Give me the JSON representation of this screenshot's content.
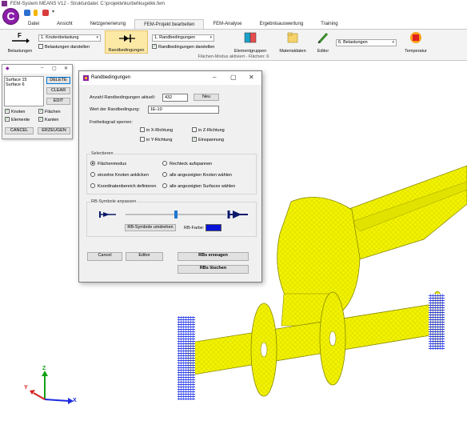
{
  "window": {
    "title": "FEM-System MEANS V12 - Strukturdatei: C:\\projekte\\kurbel\\kugelkk.fem",
    "logo_letter": "C"
  },
  "ribbon_tabs": [
    {
      "label": "Datei"
    },
    {
      "label": "Ansicht"
    },
    {
      "label": "Netzgenerierung"
    },
    {
      "label": "FEM-Projekt bearbeiten"
    },
    {
      "label": "FEM-Analyse"
    },
    {
      "label": "Ergebnisauswertung"
    },
    {
      "label": "Training"
    }
  ],
  "ribbon": {
    "belastungen_label": "Belastungen",
    "belastungen_icon_letter": "F",
    "knotenbelastung_combo": "1. Knotenbelastung",
    "belastungen_darstellen": "Belastungen darstellen",
    "randbedingungen_label": "Randbedingungen",
    "randbedingungen_combo": "1. Randbedingungen",
    "randbedingungen_darstellen": "Randbedingungen darstellen",
    "elementgruppen_label": "Elementgruppen",
    "materialdaten_label": "Materialdaten",
    "editor_label": "Editor",
    "belastungen_combo2": "6. Belastungen",
    "temperatur_label": "Temperatur",
    "group_status": "Flächen-Modus aktiviert - Flächen: 6"
  },
  "small_window": {
    "list_items": [
      "Surface 15",
      "Surface 6"
    ],
    "delete_label": "DELETE",
    "clear_label": "CLEAR",
    "edit_label": "EDIT",
    "knoten_label": "Knoten",
    "flaechen_label": "Flächen",
    "elemente_label": "Elemente",
    "kanten_label": "Kanten",
    "cancel_label": "CANCEL",
    "erzeugen_label": "ERZEUGEN"
  },
  "dialog": {
    "title": "Randbedingungen",
    "anzahl_label": "Anzahl Randbedingungen aktuell:",
    "anzahl_value": "432",
    "neu_label": "Neu",
    "wert_label": "Wert der Randbedingung:",
    "wert_value": "1E-10",
    "freiheitsgrad_label": "Freiheitsgrad sperren:",
    "in_x": "in X-Richtung",
    "in_y": "in Y-Richtung",
    "in_z": "in Z-Richtung",
    "einspannung": "Einspannung",
    "selectieren_label": "Selectieren",
    "flaechenmodus": "Flächenmodus",
    "einzelne_knoten": "einzelne Knoten anklicken",
    "koordinatenbereich": "Koordinatenbereich definieren",
    "rechteck": "Rechteck aufspannen",
    "alle_knoten": "alle angezeigten Knoten wählen",
    "alle_surfaces": "alle angezeigten Surfaces wählen",
    "rb_symbole_label": "RB-Symbole anpassen",
    "rb_symbole_umdrehen": "RB-Symbole umdrehen",
    "rb_farbe_label": "RB-Farbe:",
    "rb_farbe_color": "#0a14d8",
    "slider_value": 0.5,
    "cancel_label": "Cancel",
    "editor_label": "Editor",
    "rbs_erzeugen": "RBs erzeugen",
    "rbs_loeschen": "RBs löschen"
  },
  "axes": {
    "x": "X",
    "y": "Y",
    "z": "Z"
  },
  "colors": {
    "model": "#f2f200",
    "model_edge": "#b8b800",
    "constraints": "#1428e6",
    "accent": "#8b1fa8"
  }
}
